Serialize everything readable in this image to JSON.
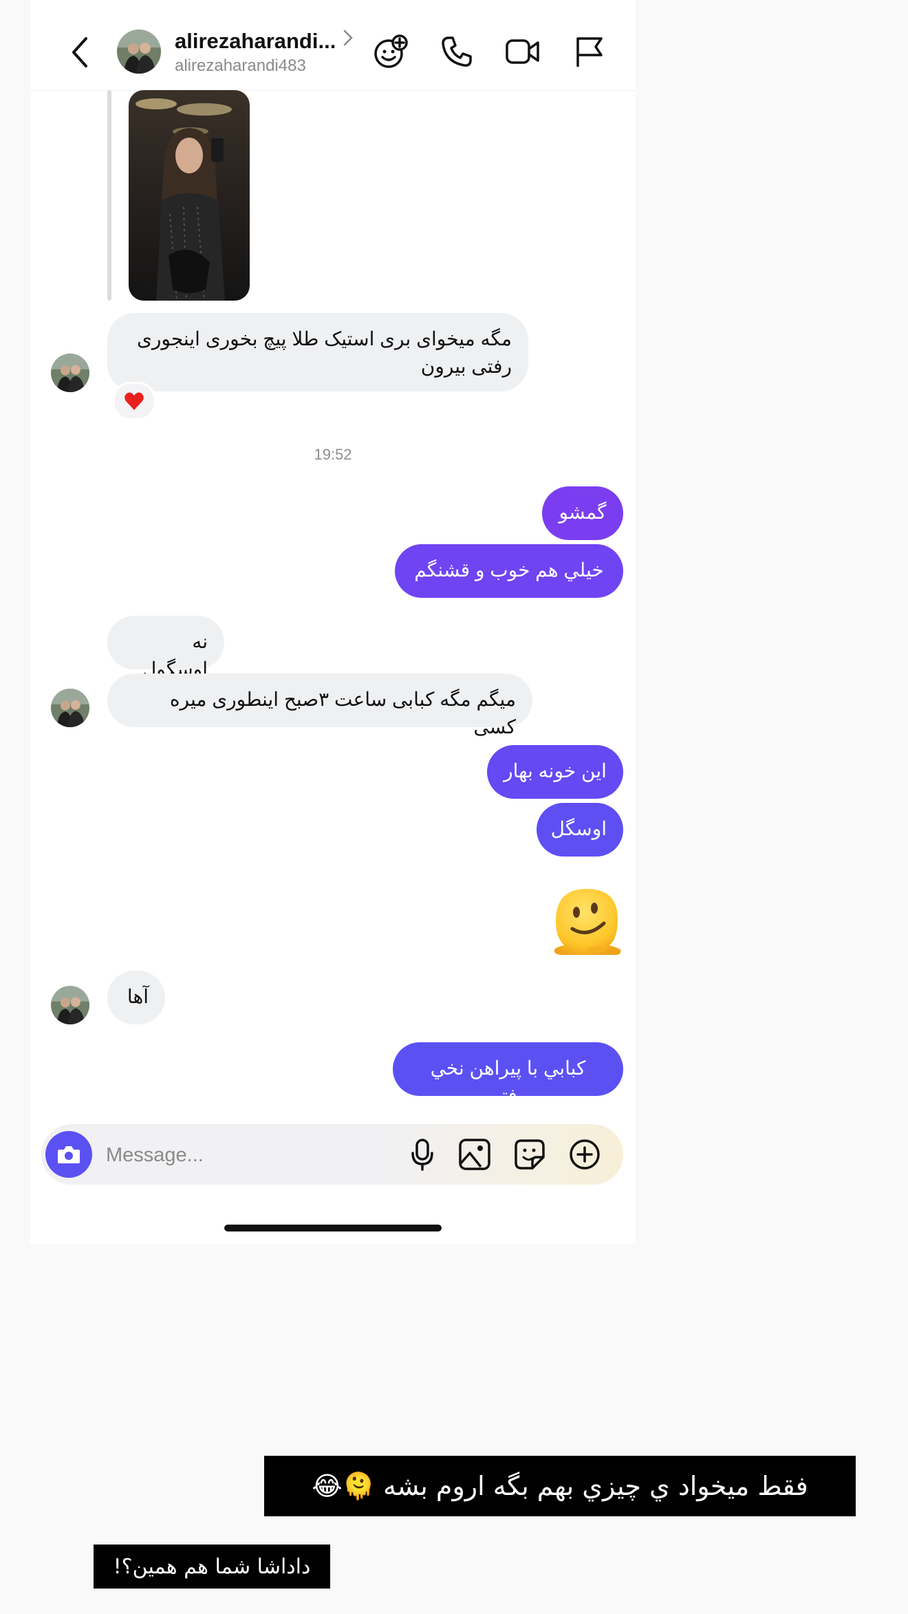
{
  "header": {
    "display_name": "alirezaharandi...",
    "username": "alirezaharandi483",
    "icons": [
      "back-icon",
      "effects-icon",
      "phone-icon",
      "video-icon",
      "flag-icon"
    ]
  },
  "thread": {
    "received_1": "مگه میخوای بری استیک طلا پیچ بخوری اینجوری رفتی بیرون",
    "reaction_1": "❤️",
    "timestamp": "19:52",
    "sent_1": "گمشو",
    "sent_2": "خيلي هم خوب و قشنگم",
    "received_2": "نه اوسگول",
    "received_3": "میگم مگه کبابی ساعت ۳صبح اینطوری میره کسی",
    "sent_3": "این خونه بهار",
    "sent_4": "اوسگل",
    "sent_emoji": "melting-face-emoji",
    "received_4": "آها",
    "sent_5": "كبابي با پيراهن نخي رفتم"
  },
  "composer": {
    "placeholder": "Message...",
    "icons": [
      "camera-icon",
      "microphone-icon",
      "gallery-icon",
      "sticker-icon",
      "plus-icon"
    ]
  },
  "captions": {
    "line_1": "فقط میخواد ي چیزي بهم بگه اروم بشه 🫠😂",
    "line_2": "داداشا شما هم همین؟!"
  },
  "colors": {
    "sent_gradient_top": "#7b3df0",
    "sent_gradient_bottom": "#5b51f3",
    "received_bubble": "#eff0f2",
    "camera_button": "#5b51f3"
  }
}
